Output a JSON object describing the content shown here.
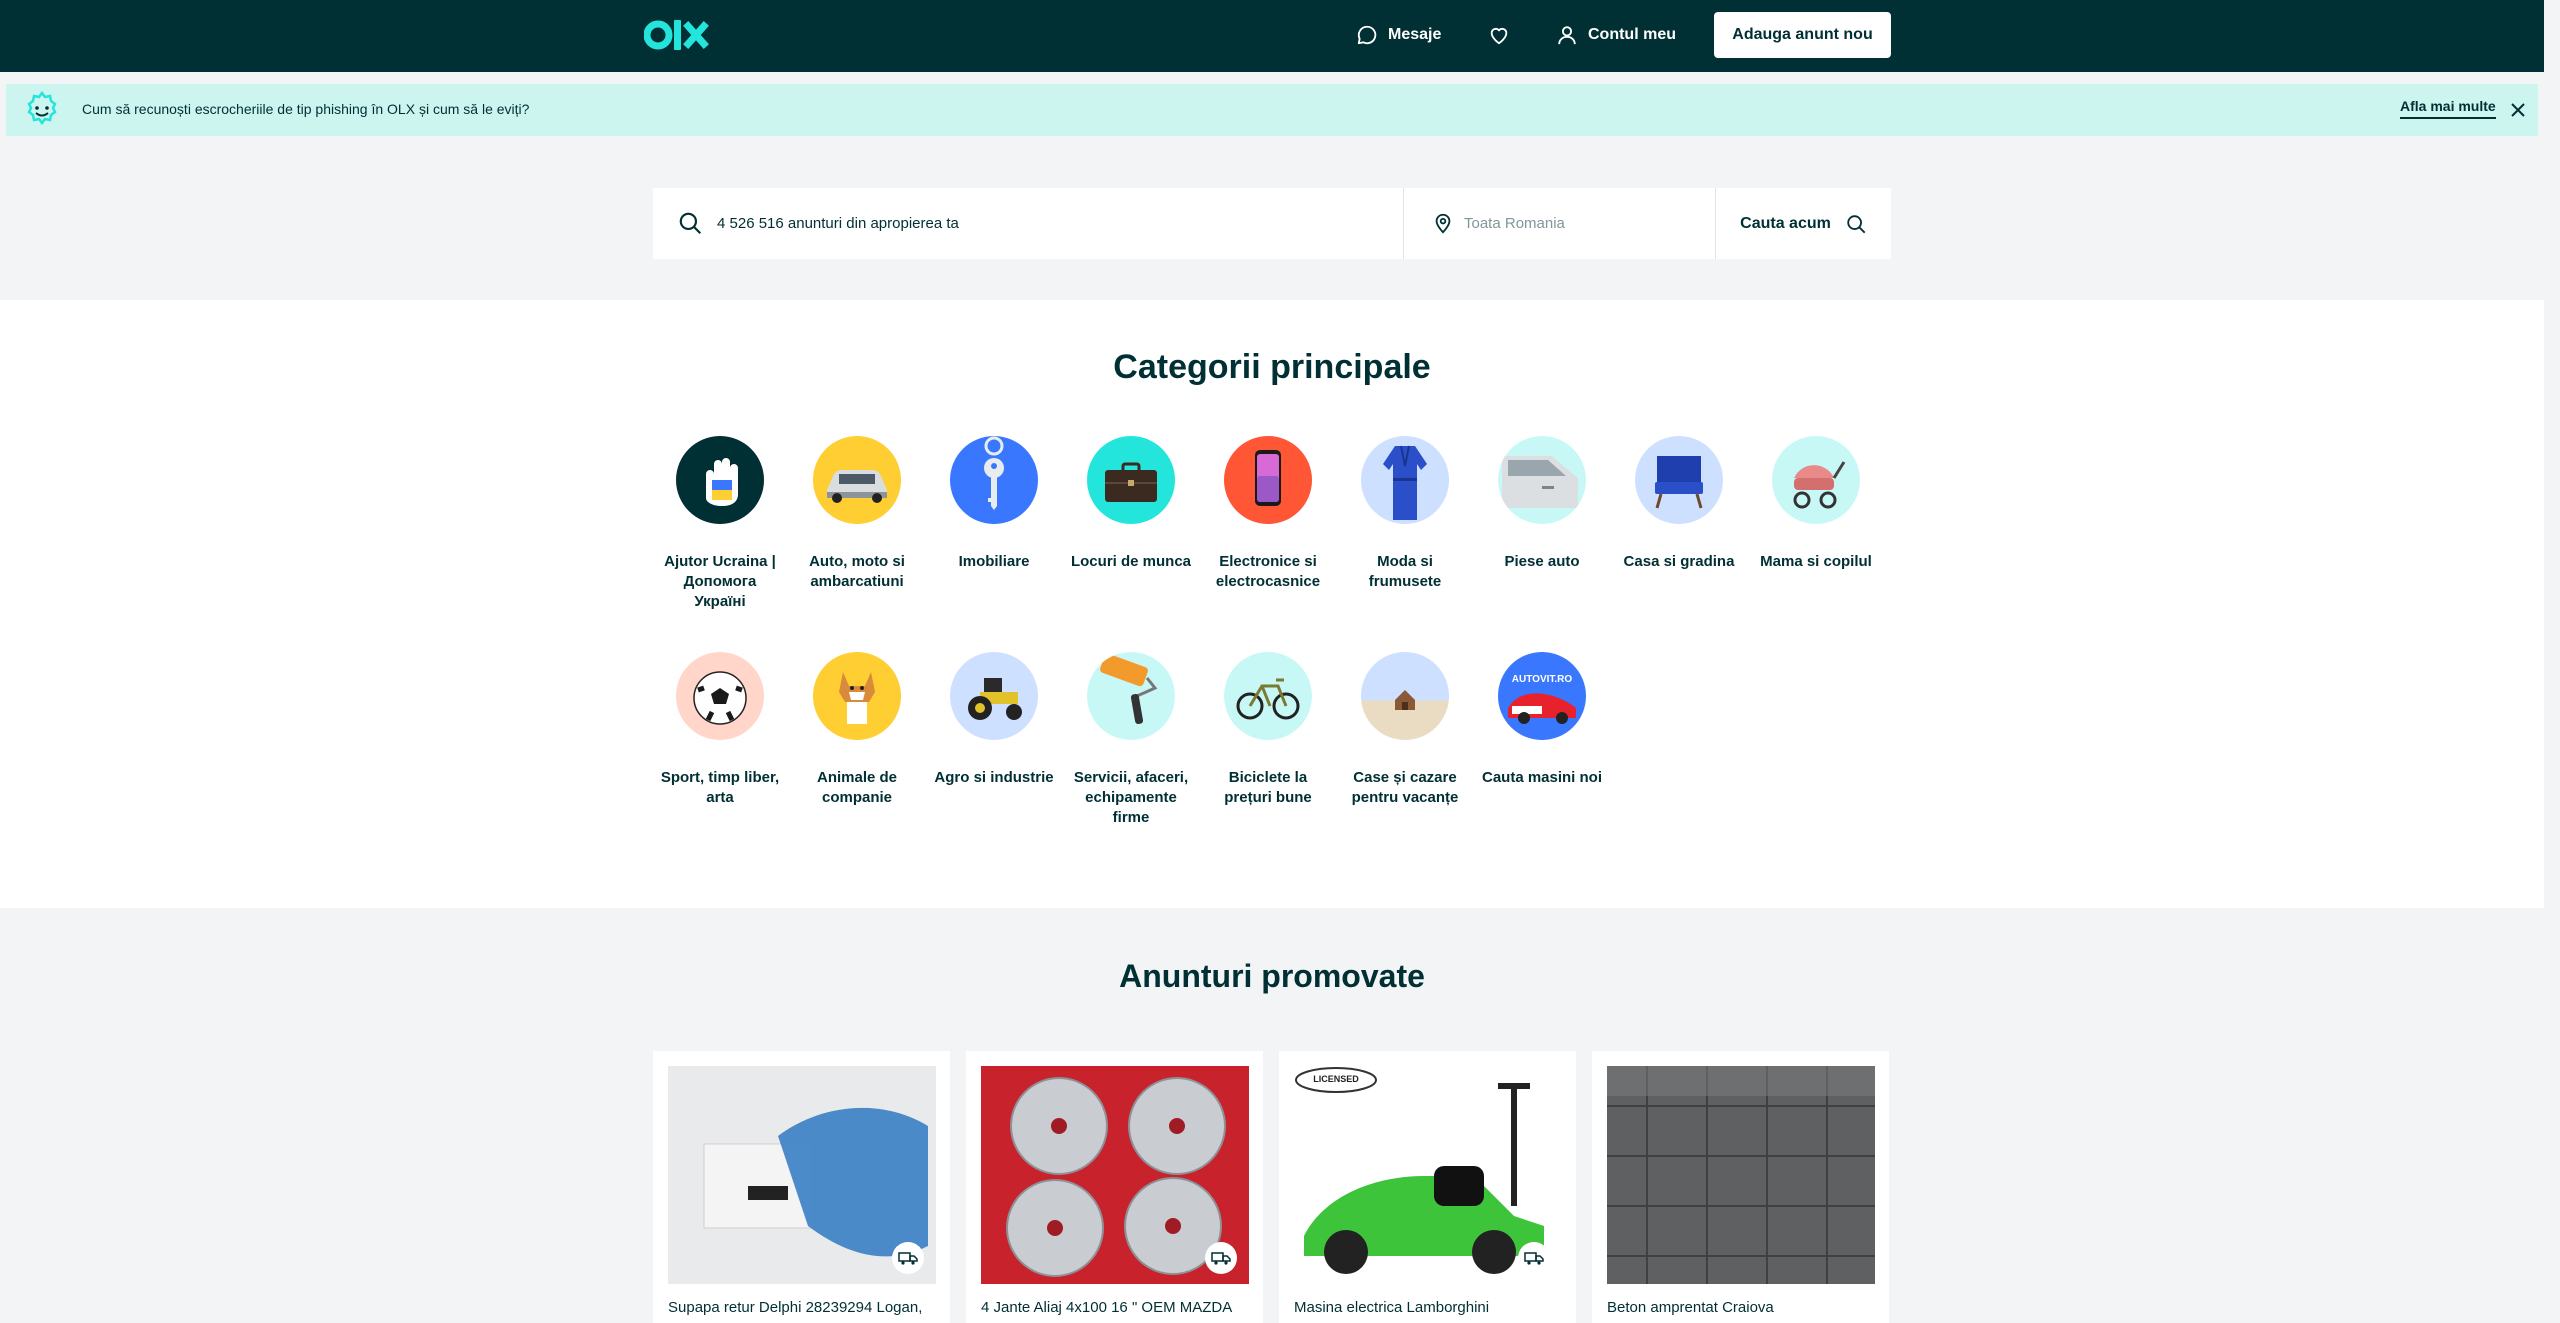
{
  "header": {
    "logo_alt": "OLX",
    "nav": {
      "messages": "Mesaje",
      "account": "Contul meu"
    },
    "post_ad": "Adauga anunt nou"
  },
  "banner": {
    "text": "Cum să recunoști escrocheriile de tip phishing în OLX și cum să le eviți?",
    "link": "Afla mai multe"
  },
  "search": {
    "query_value": "4 526 516 anunturi din apropierea ta",
    "location_placeholder": "Toata Romania",
    "button": "Cauta acum"
  },
  "categories": {
    "title": "Categorii principale",
    "items": [
      {
        "label": "Ajutor Ucraina | Допомога Україні",
        "icon": "hand-ukraine-icon",
        "bg": "#002f34"
      },
      {
        "label": "Auto, moto si ambarcatiuni",
        "icon": "car-icon",
        "bg": "#ffce32"
      },
      {
        "label": "Imobiliare",
        "icon": "key-icon",
        "bg": "#3a77ff"
      },
      {
        "label": "Locuri de munca",
        "icon": "briefcase-icon",
        "bg": "#23e5db"
      },
      {
        "label": "Electronice si electrocasnice",
        "icon": "phone-icon",
        "bg": "#ff5636"
      },
      {
        "label": "Moda si frumusete",
        "icon": "robe-icon",
        "bg": "#cee0ff"
      },
      {
        "label": "Piese auto",
        "icon": "car-door-icon",
        "bg": "#c8f8f6"
      },
      {
        "label": "Casa si gradina",
        "icon": "armchair-icon",
        "bg": "#cee0ff"
      },
      {
        "label": "Mama si copilul",
        "icon": "stroller-icon",
        "bg": "#c8f8f6"
      },
      {
        "label": "Sport, timp liber, arta",
        "icon": "football-icon",
        "bg": "#ffd6c9"
      },
      {
        "label": "Animale de companie",
        "icon": "dog-icon",
        "bg": "#ffce32"
      },
      {
        "label": "Agro si industrie",
        "icon": "tractor-icon",
        "bg": "#cee0ff"
      },
      {
        "label": "Servicii, afaceri, echipamente firme",
        "icon": "paint-roller-icon",
        "bg": "#c8f8f6"
      },
      {
        "label": "Biciclete la prețuri bune",
        "icon": "bicycle-icon",
        "bg": "#c8f8f6"
      },
      {
        "label": "Case și cazare pentru vacanțe",
        "icon": "beach-house-icon",
        "bg": "#cee0ff"
      },
      {
        "label": "Cauta masini noi",
        "icon": "autovit-icon",
        "bg": "#3a77ff",
        "badge": "AUTOVIT.RO"
      }
    ]
  },
  "promoted": {
    "title": "Anunturi promovate",
    "cards": [
      {
        "title": "Supapa retur Delphi 28239294 Logan,",
        "image": "box-bag-photo"
      },
      {
        "title": "4 Jante Aliaj 4x100 16 \" OEM MAZDA",
        "image": "alloy-wheels-photo"
      },
      {
        "title": "Masina electrica Lamborghini",
        "image": "kids-car-photo",
        "badge": "LICENSED"
      },
      {
        "title": "Beton amprentat Craiova",
        "image": "stamped-concrete-photo"
      }
    ]
  },
  "colors": {
    "brand": "#002f34",
    "accent": "#23e5db",
    "banner": "#ccf5ef"
  }
}
